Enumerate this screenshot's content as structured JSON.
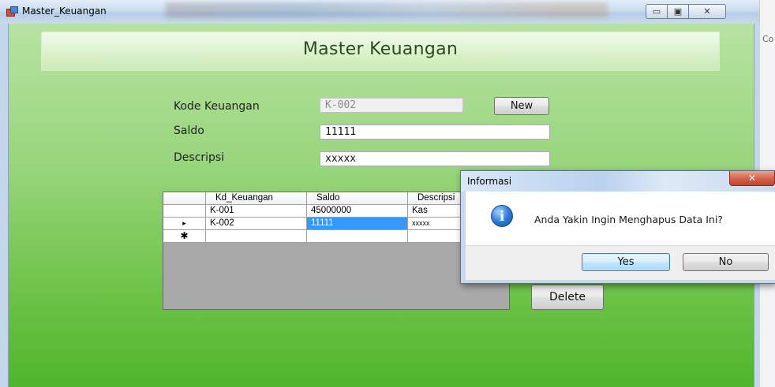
{
  "window": {
    "title": "Master_Keuangan",
    "controls": {
      "minimize": "▭",
      "maximize": "▣",
      "close": "✕"
    }
  },
  "background_window": {
    "partial_text": "Co"
  },
  "form": {
    "heading": "Master Keuangan",
    "fields": {
      "kode": {
        "label": "Kode Keuangan",
        "value": "K-002"
      },
      "saldo": {
        "label": "Saldo",
        "value": "11111"
      },
      "deskripsi": {
        "label": "Descripsi",
        "value": "xxxxx"
      }
    },
    "buttons": {
      "new": "New",
      "delete": "Delete"
    }
  },
  "grid": {
    "columns": [
      "Kd_Keuangan",
      "Saldo",
      "Descripsi"
    ],
    "rows": [
      {
        "marker": "",
        "cells": [
          "K-001",
          "45000000",
          "Kas"
        ]
      },
      {
        "marker": "▸",
        "cells": [
          "K-002",
          "11111",
          "xxxxx"
        ]
      },
      {
        "marker": "✱",
        "cells": [
          "",
          "",
          ""
        ]
      }
    ]
  },
  "dialog": {
    "title": "Informasi",
    "icon": "information-icon",
    "icon_glyph": "i",
    "close_glyph": "✕",
    "message": "Anda Yakin Ingin Menghapus Data Ini?",
    "buttons": {
      "yes": "Yes",
      "no": "No"
    }
  },
  "colors": {
    "form_bg_top": "#b7e3a2",
    "form_bg_bottom": "#4fb52b",
    "selection": "#3399ff",
    "focus_border": "#3c7fb1"
  }
}
